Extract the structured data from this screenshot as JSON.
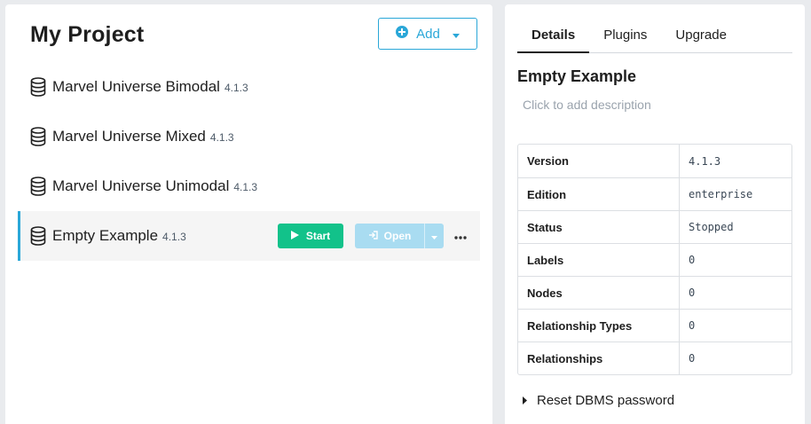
{
  "project": {
    "title": "My Project",
    "add_label": "Add",
    "databases": [
      {
        "name": "Marvel Universe Bimodal",
        "version": "4.1.3"
      },
      {
        "name": "Marvel Universe Mixed",
        "version": "4.1.3"
      },
      {
        "name": "Marvel Universe Unimodal",
        "version": "4.1.3"
      },
      {
        "name": "Empty Example",
        "version": "4.1.3",
        "start_label": "Start",
        "open_label": "Open"
      }
    ]
  },
  "details": {
    "tabs": [
      "Details",
      "Plugins",
      "Upgrade"
    ],
    "active_tab": "Details",
    "title": "Empty Example",
    "description_placeholder": "Click to add description",
    "properties": [
      {
        "key": "Version",
        "value": "4.1.3"
      },
      {
        "key": "Edition",
        "value": "enterprise"
      },
      {
        "key": "Status",
        "value": "Stopped"
      },
      {
        "key": "Labels",
        "value": "0"
      },
      {
        "key": "Nodes",
        "value": "0"
      },
      {
        "key": "Relationship Types",
        "value": "0"
      },
      {
        "key": "Relationships",
        "value": "0"
      }
    ],
    "reset_label": "Reset DBMS password"
  },
  "colors": {
    "accent": "#2aa7d8",
    "start_green": "#12c28a",
    "open_disabled": "#a9dcf1"
  },
  "icons": {
    "database": "database-icon",
    "add": "plus-circle-icon",
    "start": "play-icon",
    "open": "sign-in-icon",
    "more": "ellipsis-icon",
    "reset": "caret-right-icon"
  }
}
